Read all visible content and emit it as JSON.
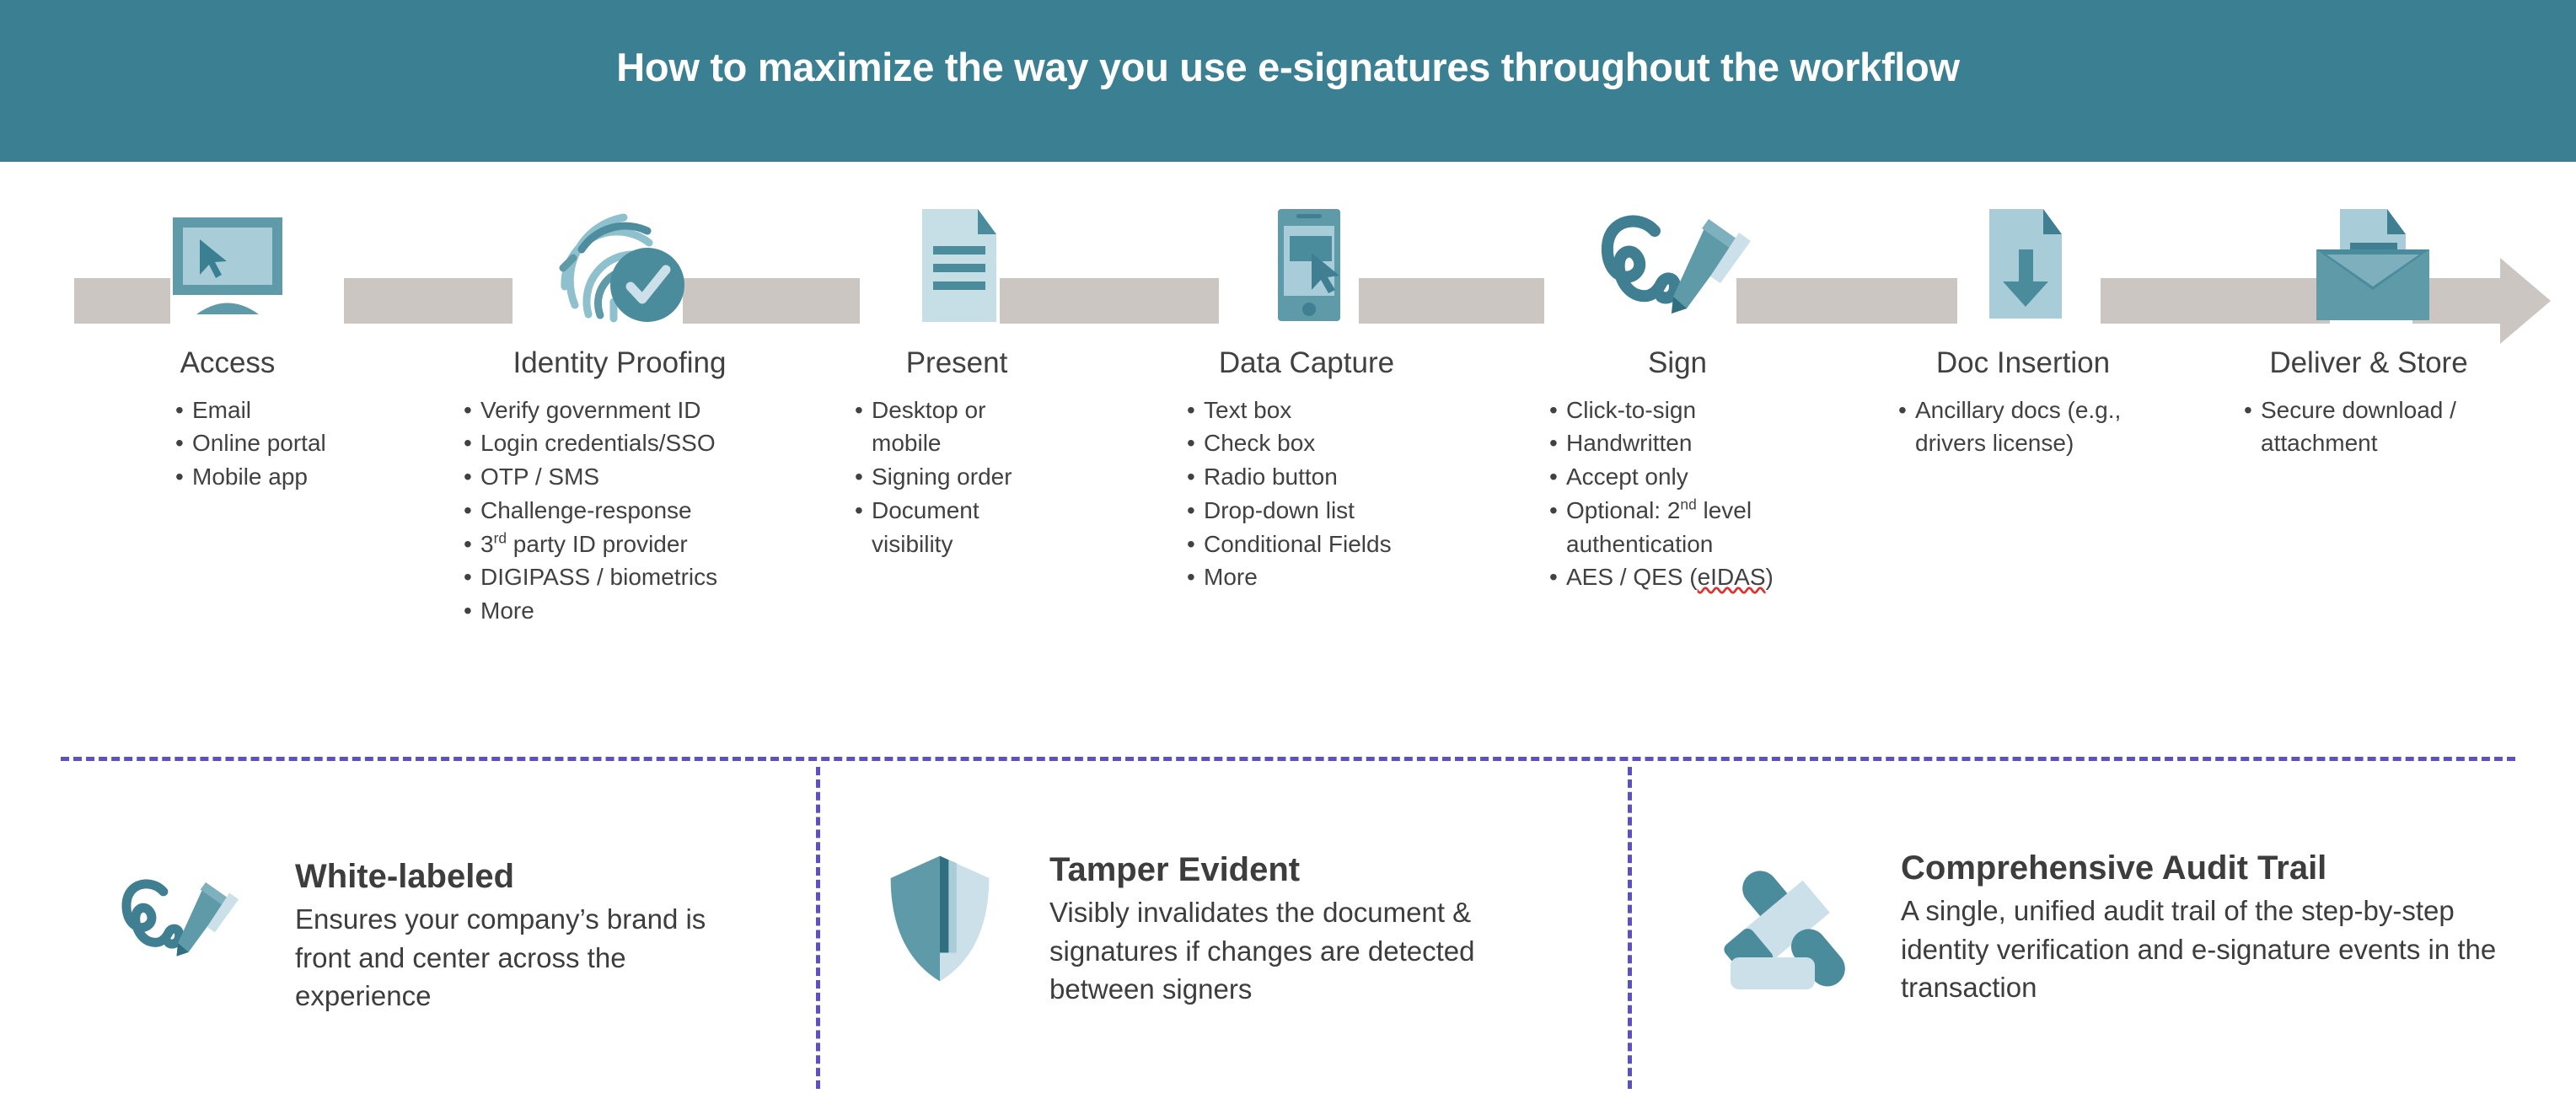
{
  "header": {
    "title": "How to maximize the way you use e-signatures throughout the workflow",
    "bg_color": "#3a8092",
    "text_color": "#ffffff"
  },
  "palette": {
    "teal_dark": "#3a8092",
    "teal_mid": "#5e9aa8",
    "teal_light": "#a8cdd8",
    "teal_pale": "#cbe0e8",
    "arrow_gray": "#cbc6c2",
    "text_gray": "#414141",
    "divider_purple": "#5b51c0",
    "spellcheck_red": "#e03131"
  },
  "workflow": {
    "steps": [
      {
        "id": "access",
        "icon": "monitor-cursor-icon",
        "title": "Access",
        "bullets": [
          "Email",
          "Online portal",
          "Mobile app"
        ]
      },
      {
        "id": "identity-proofing",
        "icon": "fingerprint-check-icon",
        "title": "Identity Proofing",
        "bullets": [
          "Verify government ID",
          "Login credentials/SSO",
          "OTP / SMS",
          "Challenge-response",
          "3rd party ID provider",
          "DIGIPASS / biometrics",
          "More"
        ]
      },
      {
        "id": "present",
        "icon": "document-lines-icon",
        "title": "Present",
        "bullets": [
          "Desktop or mobile",
          "Signing order",
          "Document visibility"
        ]
      },
      {
        "id": "data-capture",
        "icon": "mobile-form-cursor-icon",
        "title": "Data Capture",
        "bullets": [
          "Text box",
          "Check box",
          "Radio button",
          "Drop-down list",
          "Conditional Fields",
          "More"
        ]
      },
      {
        "id": "sign",
        "icon": "signature-pen-icon",
        "title": "Sign",
        "bullets": [
          "Click-to-sign",
          "Handwritten",
          "Accept only",
          "Optional: 2nd level authentication",
          "AES / QES (eIDAS)"
        ]
      },
      {
        "id": "doc-insertion",
        "icon": "document-download-icon",
        "title": "Doc Insertion",
        "bullets": [
          "Ancillary docs (e.g., drivers license)"
        ]
      },
      {
        "id": "deliver-store",
        "icon": "envelope-document-icon",
        "title": "Deliver & Store",
        "bullets": [
          "Secure download / attachment"
        ]
      }
    ]
  },
  "features": [
    {
      "id": "white-labeled",
      "icon": "signature-pen-icon",
      "title": "White-labeled",
      "description": "Ensures your company’s brand is front and center across the experience"
    },
    {
      "id": "tamper-evident",
      "icon": "shield-icon",
      "title": "Tamper Evident",
      "description": "Visibly invalidates the document & signatures if changes are detected between signers"
    },
    {
      "id": "comprehensive-audit-trail",
      "icon": "gavel-icon",
      "title": "Comprehensive Audit Trail",
      "description": "A single, unified audit trail of the step-by-step identity verification and e-signature events in the transaction"
    }
  ]
}
